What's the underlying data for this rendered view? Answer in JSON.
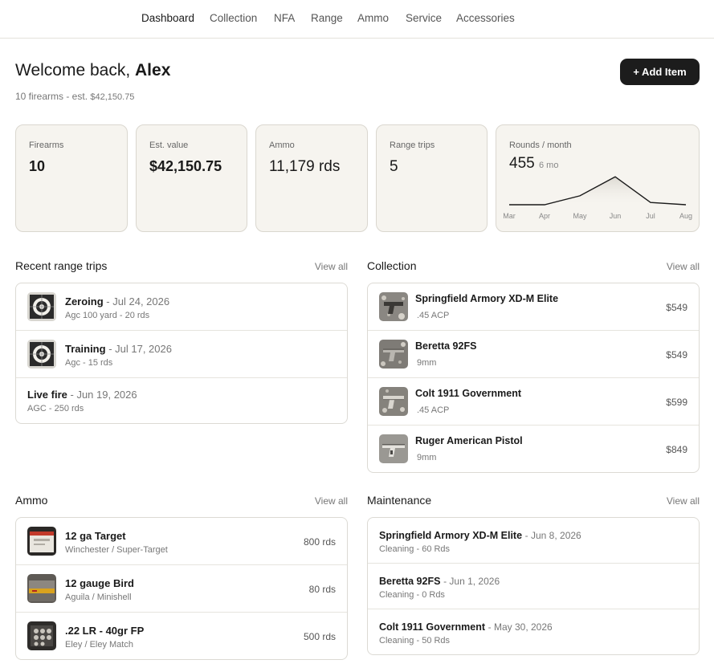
{
  "nav": {
    "items": [
      "Dashboard",
      "Collection",
      "NFA",
      "Range",
      "Ammo",
      "Service",
      "Accessories"
    ],
    "active": "Dashboard"
  },
  "header": {
    "welcome_prefix": "Welcome back,",
    "user_name": "Alex",
    "firearms_count_text": "10 firearms - est.",
    "est_value_text": "$42,150.75",
    "add_button": "+ Add Item"
  },
  "stats": {
    "firearms": {
      "label": "Firearms",
      "value": "10"
    },
    "est_value": {
      "label": "Est. value",
      "value": "$42,150.75"
    },
    "ammo": {
      "label": "Ammo",
      "value": "11,179 rds"
    },
    "range_trips": {
      "label": "Range trips",
      "value": "5"
    },
    "rounds_month": {
      "label": "Rounds / month",
      "value": "455",
      "period": "6 mo"
    }
  },
  "chart_data": {
    "type": "line",
    "categories": [
      "Mar",
      "Apr",
      "May",
      "Jun",
      "Jul",
      "Aug"
    ],
    "values": [
      0,
      0,
      80,
      250,
      20,
      0
    ],
    "ylim": [
      0,
      280
    ],
    "grid": false,
    "title": "",
    "xlabel": "",
    "ylabel": ""
  },
  "range_trips": {
    "title": "Recent range trips",
    "view_all": "View all",
    "items": [
      {
        "name": "Zeroing",
        "date": "Jul 24, 2026",
        "sub": "Agc 100 yard - 20 rds",
        "thumb": "target-icon"
      },
      {
        "name": "Training",
        "date": "Jul 17, 2026",
        "sub": "Agc - 15 rds",
        "thumb": "target-icon"
      },
      {
        "name": "Live fire",
        "date": "Jun 19, 2026",
        "sub": "AGC - 250 rds"
      }
    ]
  },
  "collection": {
    "title": "Collection",
    "view_all": "View all",
    "items": [
      {
        "name": "Springfield Armory XD-M Elite",
        "caliber": ".45 ACP",
        "price": "$549"
      },
      {
        "name": "Beretta 92FS",
        "caliber": "9mm",
        "price": "$549"
      },
      {
        "name": "Colt 1911 Government",
        "caliber": ".45 ACP",
        "price": "$599"
      },
      {
        "name": "Ruger American Pistol",
        "caliber": "9mm",
        "price": "$849"
      }
    ]
  },
  "ammo": {
    "title": "Ammo",
    "view_all": "View all",
    "items": [
      {
        "name": "12 ga Target",
        "sub": "Winchester / Super-Target",
        "qty": "800 rds"
      },
      {
        "name": "12 gauge Bird",
        "sub": "Aguila / Minishell",
        "qty": "80 rds"
      },
      {
        "name": ".22 LR - 40gr FP",
        "sub": "Eley / Eley Match",
        "qty": "500 rds"
      }
    ]
  },
  "maintenance": {
    "title": "Maintenance",
    "view_all": "View all",
    "items": [
      {
        "name": "Springfield Armory XD-M Elite",
        "date": "Jun 8, 2026",
        "sub": "Cleaning - 60 Rds"
      },
      {
        "name": "Beretta 92FS",
        "date": "Jun 1, 2026",
        "sub": "Cleaning - 0 Rds"
      },
      {
        "name": "Colt 1911 Government",
        "date": "May 30, 2026",
        "sub": "Cleaning - 50 Rds"
      }
    ]
  },
  "colors": {
    "accent_dark": "#1c1c1c",
    "card_bg": "#f6f4ef",
    "border": "#dcdad4"
  }
}
